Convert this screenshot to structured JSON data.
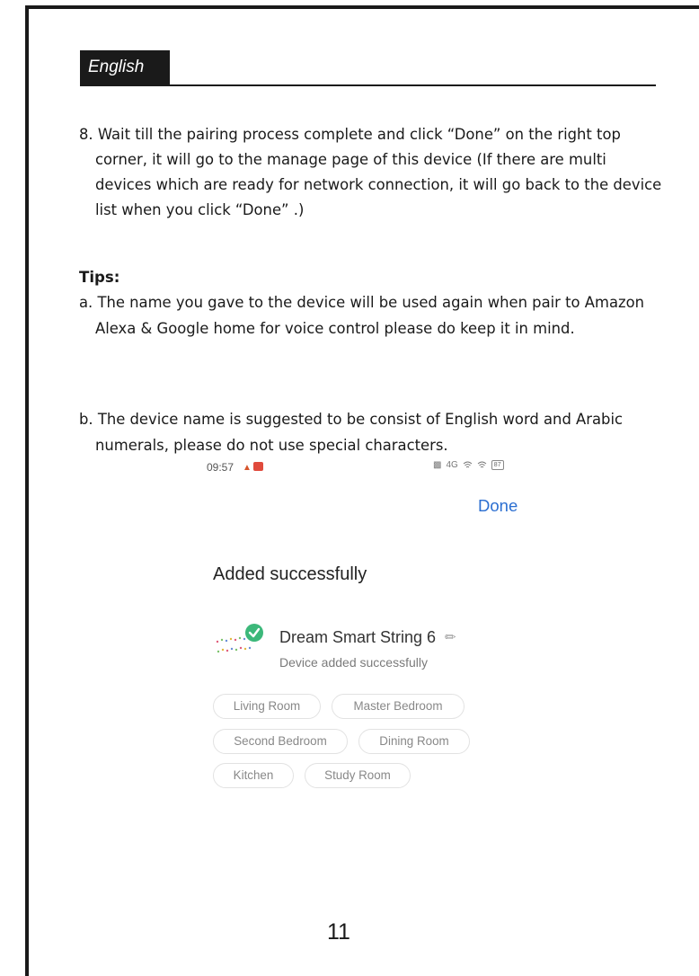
{
  "header": {
    "language": "English"
  },
  "step8": "8. Wait till the pairing process complete and click “Done” on the right top corner, it will go to the manage page of this device (If there are multi devices which are ready for network connection, it will go back to the device list when you click “Done” .)",
  "tips": {
    "heading": "Tips:",
    "a": "a. The name you gave to the device will be used again when pair to Amazon Alexa & Google home for voice control please do keep it in mind.",
    "b": "b. The device name is suggested to be consist of English word and Arabic numerals, please do not use special characters."
  },
  "phone": {
    "status_time": "09:57",
    "status_network": "4G",
    "battery": "87",
    "done_label": "Done",
    "title": "Added successfully",
    "device_name": "Dream Smart String 6",
    "device_status": "Device added successfully",
    "rooms": [
      "Living Room",
      "Master Bedroom",
      "Second Bedroom",
      "Dining Room",
      "Kitchen",
      "Study Room"
    ],
    "accent_color": "#2c6fd1",
    "check_color": "#3cb87a"
  },
  "page_number": "11"
}
